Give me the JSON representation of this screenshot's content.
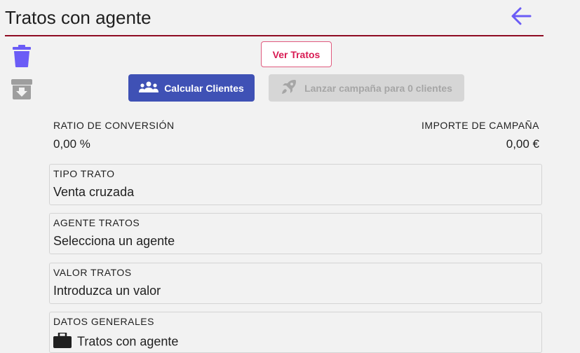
{
  "header": {
    "title": "Tratos con agente",
    "back_icon": "arrow-left-icon",
    "back_color": "#6b5cf6",
    "rule_color": "#8f0b22"
  },
  "sidebar": {
    "delete_icon": "trash-icon",
    "delete_color": "#6b5cf6",
    "archive_icon": "archive-download-icon",
    "archive_color": "#9e9e9e"
  },
  "actions": {
    "ver_tratos_label": "Ver Tratos",
    "calcular_label": "Calcular Clientes",
    "calcular_icon": "people-group-icon",
    "lanzar_label": "Lanzar campaña para 0 clientes",
    "lanzar_icon": "rocket-icon"
  },
  "stats": {
    "ratio_label": "RATIO DE CONVERSIÓN",
    "ratio_value": "0,00 %",
    "importe_label": "IMPORTE DE CAMPAÑA",
    "importe_value": "0,00 €"
  },
  "fields": [
    {
      "label": "TIPO TRATO",
      "value": "Venta cruzada"
    },
    {
      "label": "AGENTE TRATOS",
      "value": "Selecciona un agente"
    },
    {
      "label": "VALOR TRATOS",
      "value": "Introduzca un valor"
    },
    {
      "label": "DATOS GENERALES",
      "value": "Tratos con agente",
      "icon": "briefcase-icon"
    }
  ],
  "colors": {
    "primary": "#3f51b5",
    "accent_pink": "#d81b53",
    "background": "#f2f2f2"
  }
}
